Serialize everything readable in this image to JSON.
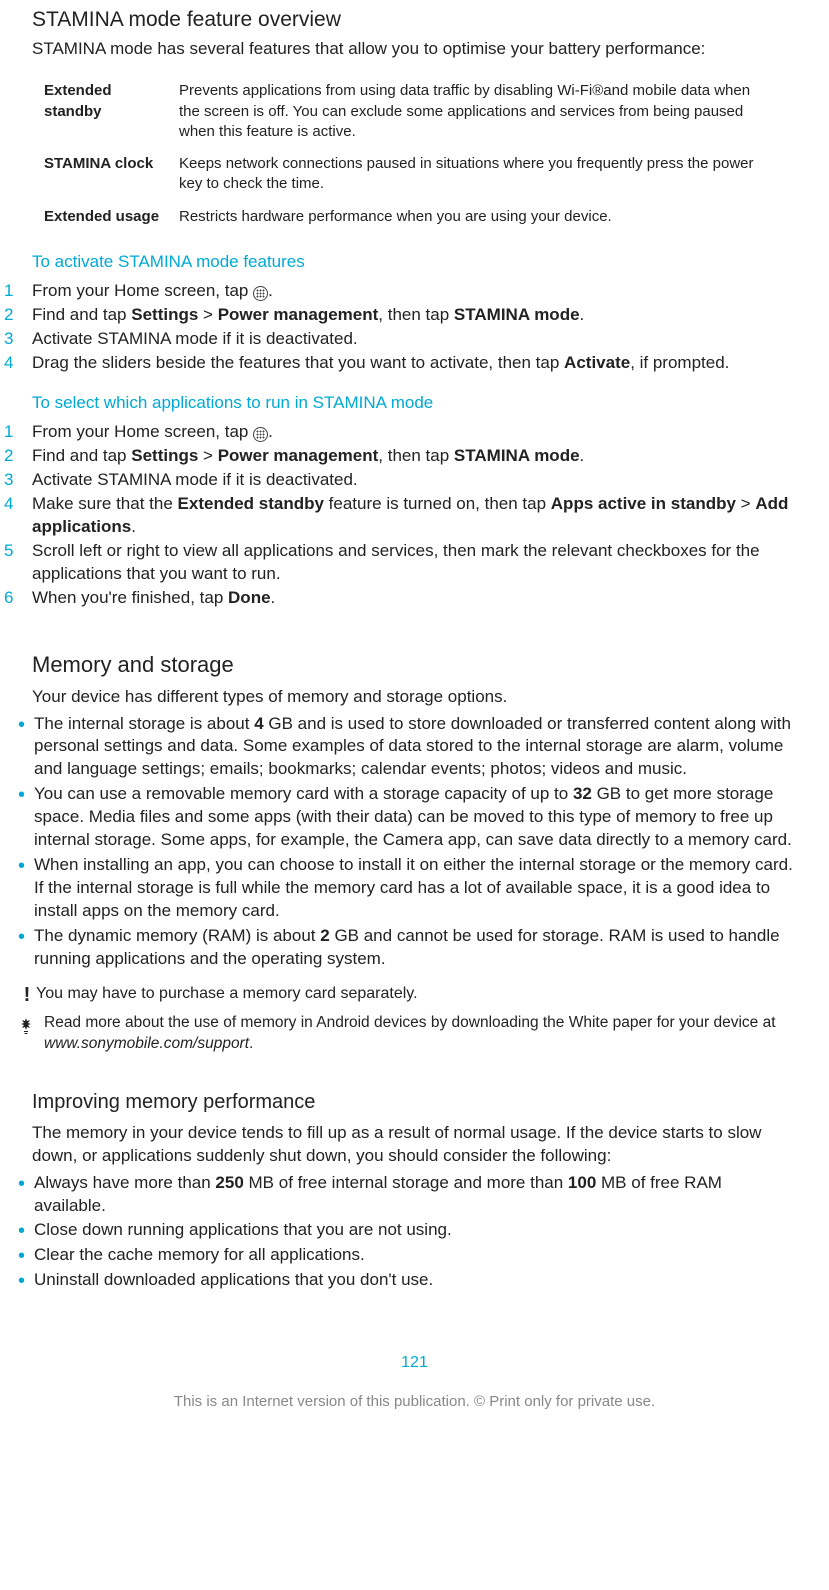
{
  "overview": {
    "title": "STAMINA mode feature overview",
    "intro": "STAMINA mode has several features that allow you to optimise your battery performance:",
    "features": [
      {
        "name": "Extended standby",
        "desc": "Prevents applications from using data traffic by disabling Wi-Fi®and mobile data when the screen is off. You can exclude some applications and services from being paused when this feature is active."
      },
      {
        "name": "STAMINA clock",
        "desc": "Keeps network connections paused in situations where you frequently press the power key to check the time."
      },
      {
        "name": "Extended usage",
        "desc": "Restricts hardware performance when you are using your device."
      }
    ]
  },
  "proc1": {
    "title": "To activate STAMINA mode features",
    "steps": [
      {
        "pre": "From your Home screen, tap ",
        "icon": true,
        "post": "."
      },
      {
        "pre": "Find and tap ",
        "b1": "Settings",
        "mid1": " > ",
        "b2": "Power management",
        "mid2": ", then tap ",
        "b3": "STAMINA mode",
        "post": "."
      },
      {
        "pre": "Activate STAMINA mode if it is deactivated."
      },
      {
        "pre": "Drag the sliders beside the features that you want to activate, then tap ",
        "b1": "Activate",
        "post": ", if prompted."
      }
    ]
  },
  "proc2": {
    "title": "To select which applications to run in STAMINA mode",
    "steps": [
      {
        "pre": "From your Home screen, tap ",
        "icon": true,
        "post": "."
      },
      {
        "pre": "Find and tap ",
        "b1": "Settings",
        "mid1": " > ",
        "b2": "Power management",
        "mid2": ", then tap ",
        "b3": "STAMINA mode",
        "post": "."
      },
      {
        "pre": "Activate STAMINA mode if it is deactivated."
      },
      {
        "pre": "Make sure that the ",
        "b1": "Extended standby",
        "mid1": " feature is turned on, then tap ",
        "b2": "Apps active in standby",
        "mid2": " > ",
        "b3": "Add applications",
        "post": "."
      },
      {
        "pre": "Scroll left or right to view all applications and services, then mark the relevant checkboxes for the applications that you want to run."
      },
      {
        "pre": "When you're finished, tap ",
        "b1": "Done",
        "post": "."
      }
    ]
  },
  "memory": {
    "title": "Memory and storage",
    "intro": "Your device has different types of memory and storage options.",
    "bullets": [
      {
        "pre": "The internal storage is about ",
        "b1": "4",
        "mid1": " GB and is used to store downloaded or transferred content along with personal settings and data. Some examples of data stored to the internal storage are alarm, volume and language settings; emails; bookmarks; calendar events; photos; videos and music."
      },
      {
        "pre": "You can use a removable memory card with a storage capacity of up to ",
        "b1": "32",
        "mid1": " GB to get more storage space. Media files and some apps (with their data) can be moved to this type of memory to free up internal storage. Some apps, for example, the Camera app, can save data directly to a memory card."
      },
      {
        "pre": "When installing an app, you can choose to install it on either the internal storage or the memory card. If the internal storage is full while the memory card has a lot of available space, it is a good idea to install apps on the memory card."
      },
      {
        "pre": "The dynamic memory (RAM) is about ",
        "b1": "2",
        "mid1": " GB and cannot be used for storage. RAM is used to handle running applications and the operating system."
      }
    ],
    "note": "You may have to purchase a memory card separately.",
    "tip_pre": "Read more about the use of memory in Android devices by downloading the White paper for your device at ",
    "tip_link": "www.sonymobile.com/support",
    "tip_post": "."
  },
  "improve": {
    "title": "Improving memory performance",
    "intro": "The memory in your device tends to fill up as a result of normal usage. If the device starts to slow down, or applications suddenly shut down, you should consider the following:",
    "bullets": [
      {
        "pre": "Always have more than ",
        "b1": "250",
        "mid1": " MB of free internal storage and more than ",
        "b2": "100",
        "mid2": " MB of free RAM available."
      },
      {
        "pre": "Close down running applications that you are not using."
      },
      {
        "pre": "Clear the cache memory for all applications."
      },
      {
        "pre": "Uninstall downloaded applications that you don't use."
      }
    ]
  },
  "pagenum": "121",
  "footer": "This is an Internet version of this publication. © Print only for private use."
}
